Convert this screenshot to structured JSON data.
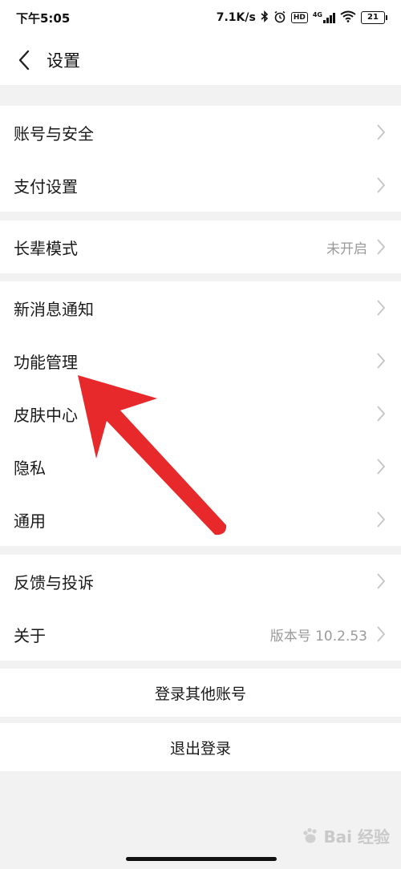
{
  "status_bar": {
    "time": "下午5:05",
    "speed": "7.1K/s",
    "network": "4G",
    "hd_label": "HD",
    "battery": "21"
  },
  "nav": {
    "title": "设置"
  },
  "groups": [
    {
      "rows": [
        {
          "label": "账号与安全"
        },
        {
          "label": "支付设置"
        }
      ]
    },
    {
      "rows": [
        {
          "label": "长辈模式",
          "value": "未开启"
        }
      ]
    },
    {
      "rows": [
        {
          "label": "新消息通知"
        },
        {
          "label": "功能管理"
        },
        {
          "label": "皮肤中心"
        },
        {
          "label": "隐私"
        },
        {
          "label": "通用"
        }
      ]
    },
    {
      "rows": [
        {
          "label": "反馈与投诉"
        },
        {
          "label": "关于",
          "value": "版本号 10.2.53"
        }
      ]
    }
  ],
  "actions": {
    "switch_account": "登录其他账号",
    "logout": "退出登录"
  },
  "watermark": {
    "text": "Bai 经验"
  },
  "colors": {
    "annotation_arrow": "#e8292b",
    "background": "#f2f2f2",
    "value_text": "#9a9a9a"
  }
}
